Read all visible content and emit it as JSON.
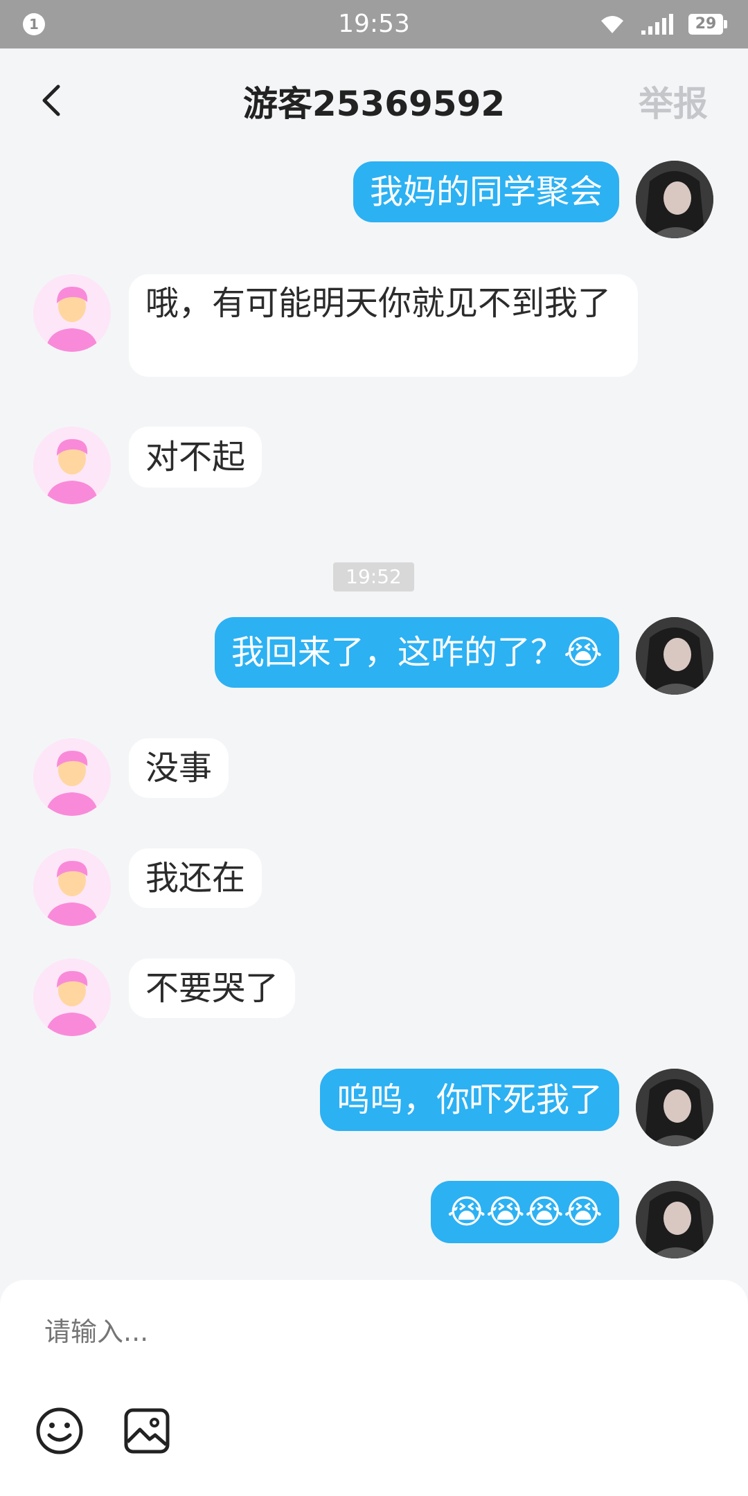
{
  "status_bar": {
    "notification_count": "1",
    "time": "19:53",
    "battery": "29"
  },
  "header": {
    "title": "游客25369592",
    "report_label": "举报",
    "back_icon": "chevron-left-icon"
  },
  "messages": [
    {
      "side": "right",
      "text": "我妈的同学聚会"
    },
    {
      "side": "left",
      "text": "哦，有可能明天你就见不到我了"
    },
    {
      "side": "left",
      "text": "对不起"
    },
    {
      "side": "right",
      "text": "我回来了，这咋的了？😭"
    },
    {
      "side": "left",
      "text": "没事"
    },
    {
      "side": "left",
      "text": "我还在"
    },
    {
      "side": "left",
      "text": "不要哭了"
    },
    {
      "side": "right",
      "text": "呜呜，你吓死我了"
    },
    {
      "side": "right",
      "text": "😭😭😭😭"
    }
  ],
  "timestamp": "19:52",
  "input": {
    "placeholder": "请输入..."
  },
  "toolbar": {
    "emoji_icon": "smiley-icon",
    "image_icon": "image-icon"
  },
  "colors": {
    "accent": "#2cb1f3",
    "status_bar": "#9e9e9e",
    "background": "#f4f5f7",
    "bubble_left": "#ffffff",
    "report_text": "#c4c6ca"
  }
}
